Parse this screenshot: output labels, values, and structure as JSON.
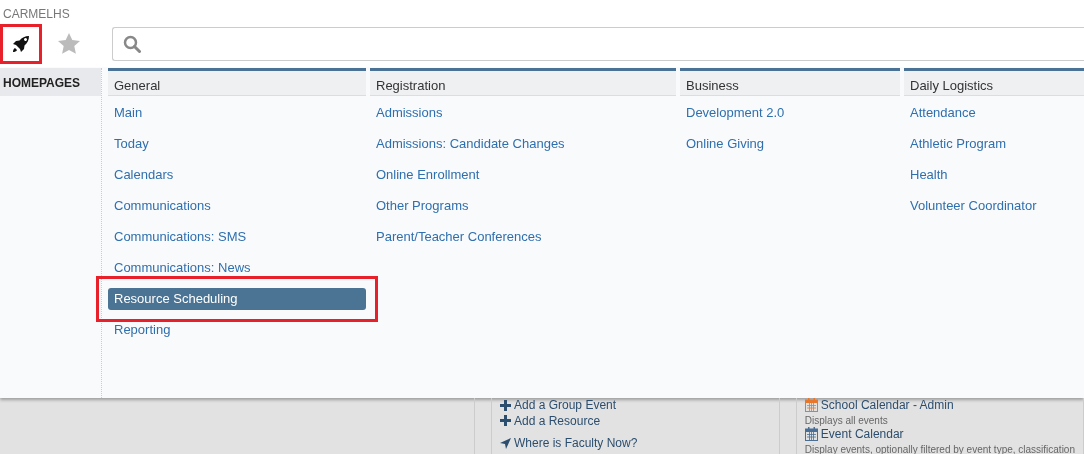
{
  "site": "CARMELHS",
  "toolbar": [
    {
      "kind": "rocket",
      "selected": true,
      "highlighted": true
    },
    {
      "kind": "star",
      "selected": false,
      "highlighted": false
    }
  ],
  "sidebar": {
    "items": [
      {
        "label": "HOMEPAGES",
        "selected": true
      }
    ]
  },
  "menu": {
    "columns": [
      {
        "title": "General",
        "items": [
          {
            "label": "Main",
            "selected": false,
            "highlighted": false
          },
          {
            "label": "Today",
            "selected": false,
            "highlighted": false
          },
          {
            "label": "Calendars",
            "selected": false,
            "highlighted": false
          },
          {
            "label": "Communications",
            "selected": false,
            "highlighted": false
          },
          {
            "label": "Communications: SMS",
            "selected": false,
            "highlighted": false
          },
          {
            "label": "Communications: News",
            "selected": false,
            "highlighted": false
          },
          {
            "label": "Resource Scheduling",
            "selected": true,
            "highlighted": true
          },
          {
            "label": "Reporting",
            "selected": false,
            "highlighted": false
          }
        ]
      },
      {
        "title": "Registration",
        "items": [
          {
            "label": "Admissions",
            "selected": false,
            "highlighted": false
          },
          {
            "label": "Admissions: Candidate Changes",
            "selected": false,
            "highlighted": false
          },
          {
            "label": "Online Enrollment",
            "selected": false,
            "highlighted": false
          },
          {
            "label": "Other Programs",
            "selected": false,
            "highlighted": false
          },
          {
            "label": "Parent/Teacher Conferences",
            "selected": false,
            "highlighted": false
          }
        ]
      },
      {
        "title": "Business",
        "items": [
          {
            "label": "Development 2.0",
            "selected": false,
            "highlighted": false
          },
          {
            "label": "Online Giving",
            "selected": false,
            "highlighted": false
          }
        ]
      },
      {
        "title": "Daily Logistics",
        "items": [
          {
            "label": "Attendance",
            "selected": false,
            "highlighted": false
          },
          {
            "label": "Athletic Program",
            "selected": false,
            "highlighted": false
          },
          {
            "label": "Health",
            "selected": false,
            "highlighted": false
          },
          {
            "label": "Volunteer Coordinator",
            "selected": false,
            "highlighted": false
          }
        ]
      }
    ]
  },
  "panels": [
    {
      "items": [
        {
          "kind": "plus",
          "label": "Add a Group Event"
        },
        {
          "kind": "plus",
          "label": "Add a Resource"
        },
        {
          "kind": "location",
          "label": "Where is Faculty Now?"
        }
      ]
    },
    {
      "items": [
        {
          "kind": "calendar",
          "label": "School Calendar - Admin",
          "color": "#e8772e"
        },
        {
          "kind": "note",
          "label": "Displays all events"
        },
        {
          "kind": "calendar",
          "label": "Event Calendar",
          "color": "#4a6f96"
        },
        {
          "kind": "note",
          "label": "Display events, optionally filtered by event type, classification"
        }
      ]
    }
  ]
}
